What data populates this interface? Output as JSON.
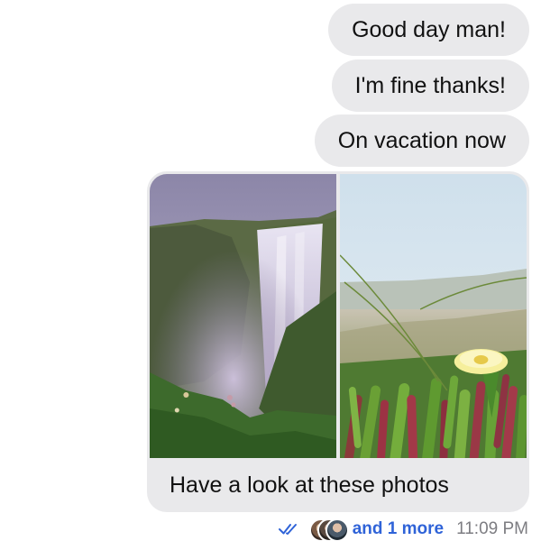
{
  "messages": [
    {
      "text": "Good day man!"
    },
    {
      "text": "I'm fine thanks!"
    },
    {
      "text": "On vacation now"
    }
  ],
  "media_message": {
    "photos": [
      {
        "subject": "waterfall"
      },
      {
        "subject": "yellow flower among succulents"
      }
    ],
    "caption": "Have a look at these photos"
  },
  "read_receipt": {
    "status_icon": "double-check-icon",
    "more_label": "and 1 more",
    "time": "11:09 PM",
    "accent_color": "#2f63d8"
  },
  "colors": {
    "bubble": "#e9e9eb",
    "text": "#111111",
    "meta": "#7d7d82"
  }
}
